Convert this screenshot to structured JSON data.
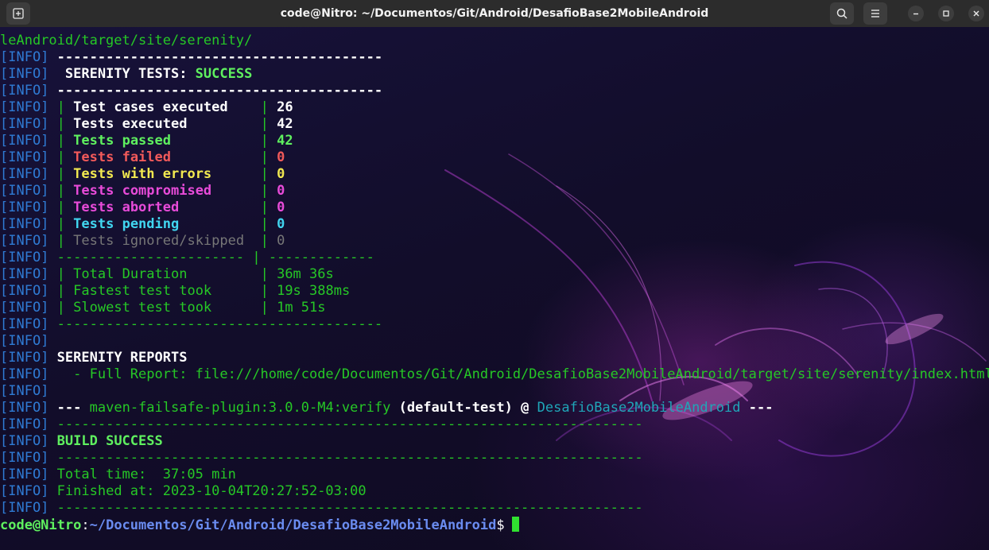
{
  "window": {
    "title": "code@Nitro: ~/Documentos/Git/Android/DesafioBase2MobileAndroid",
    "buttons": [
      "new-tab",
      "search",
      "menu",
      "minimize",
      "maximize",
      "close"
    ]
  },
  "colors": {
    "info": "#2f7bd4",
    "success": "#5ff05f",
    "failed": "#f25a5a",
    "errors": "#f2e950",
    "compromised": "#e84bd9",
    "pending": "#41d6f0",
    "ignored": "#777777"
  },
  "tag": "[INFO]",
  "path_fragment": "leAndroid/target/site/serenity/",
  "rule_short": "----------------------------------------",
  "rule_split_left": "-----------------------",
  "rule_split_right": "-------------",
  "rule_long": "------------------------------------------------------------------------",
  "sep": "|",
  "serenity_tests_label": " SERENITY TESTS: ",
  "serenity_tests_status": "SUCCESS",
  "rows": [
    {
      "label": "Test cases executed    ",
      "value": "26"
    },
    {
      "label": "Tests executed         ",
      "value": "42"
    },
    {
      "label": "Tests passed           ",
      "value": "42"
    },
    {
      "label": "Tests failed           ",
      "value": "0"
    },
    {
      "label": "Tests with errors      ",
      "value": "0"
    },
    {
      "label": "Tests compromised      ",
      "value": "0"
    },
    {
      "label": "Tests aborted          ",
      "value": "0"
    },
    {
      "label": "Tests pending          ",
      "value": "0"
    },
    {
      "label": "Tests ignored/skipped  ",
      "value": "0"
    }
  ],
  "durations": [
    {
      "label": "Total Duration         ",
      "value": "36m 36s"
    },
    {
      "label": "Fastest test took      ",
      "value": "19s 388ms"
    },
    {
      "label": "Slowest test took      ",
      "value": "1m 51s"
    }
  ],
  "reports_heading": "SERENITY REPORTS",
  "full_report": "  - Full Report: file:///home/code/Documentos/Git/Android/DesafioBase2MobileAndroid/target/site/serenity/index.html",
  "maven": {
    "dashes": "---",
    "plugin": "maven-failsafe-plugin:3.0.0-M4:verify",
    "execution": "(default-test)",
    "at": "@",
    "project": "DesafioBase2MobileAndroid"
  },
  "build_success": "BUILD SUCCESS",
  "total_time": "Total time:  37:05 min",
  "finished_at": "Finished at: 2023-10-04T20:27:52-03:00",
  "prompt": {
    "user": "code@Nitro",
    "colon": ":",
    "path": "~/Documentos/Git/Android/DesafioBase2MobileAndroid",
    "dollar": "$"
  }
}
